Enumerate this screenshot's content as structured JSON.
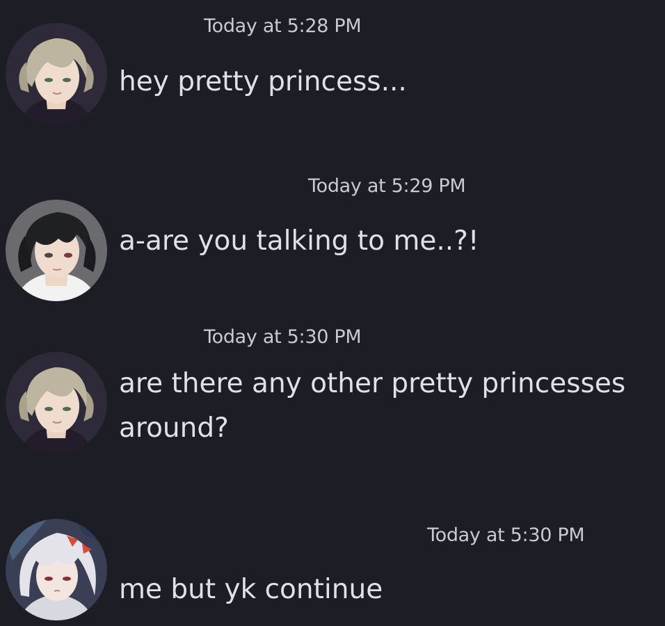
{
  "messages": [
    {
      "timestamp": "Today at 5:28 PM",
      "lines": [
        "hey pretty princess..."
      ],
      "avatar_icon": "blonde-braided-character-avatar-icon",
      "hair_color": "#b8b09a"
    },
    {
      "timestamp": "Today at 5:29 PM",
      "lines": [
        "a-are you talking to me..?!"
      ],
      "avatar_icon": "dark-haired-character-avatar-icon",
      "hair_color": "#1f2023"
    },
    {
      "timestamp": "Today at 5:30 PM",
      "lines": [
        "are there any other pretty princesses",
        "around?"
      ],
      "avatar_icon": "blonde-braided-character-avatar-icon",
      "hair_color": "#b8b09a"
    },
    {
      "timestamp": "Today at 5:30 PM",
      "lines": [
        "me but yk continue"
      ],
      "avatar_icon": "white-haired-character-avatar-icon",
      "hair_color": "#e4e3ea"
    }
  ],
  "colors": {
    "background": "#1c1d25",
    "text": "#dfe1e6",
    "timestamp": "#c9cbd1"
  }
}
